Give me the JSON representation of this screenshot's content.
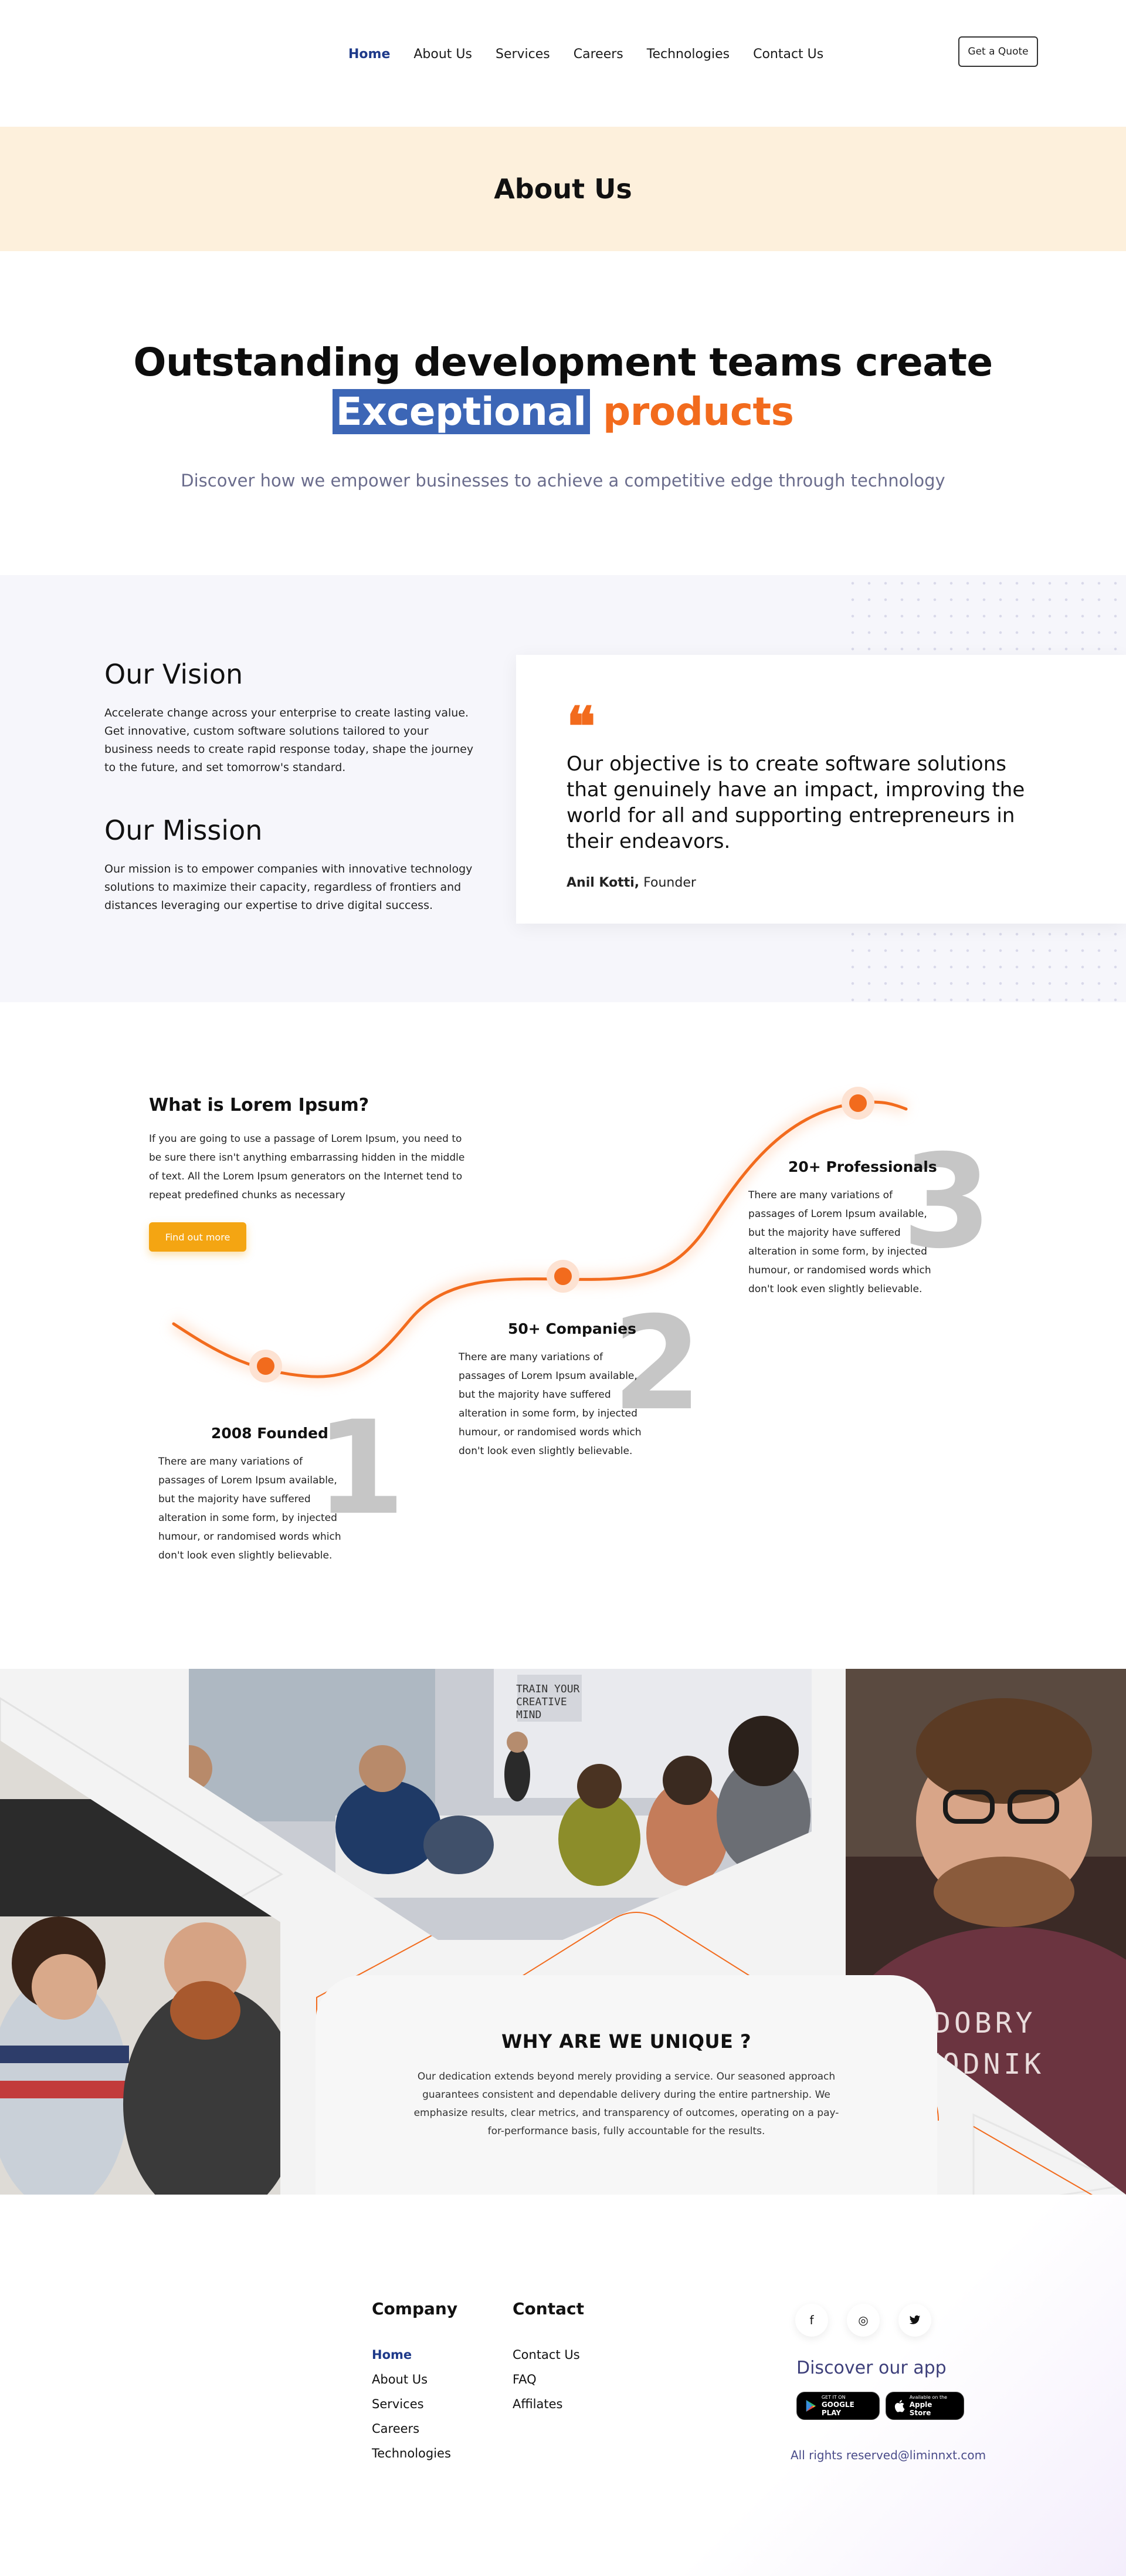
{
  "nav": {
    "links": [
      {
        "label": "Home",
        "active": true
      },
      {
        "label": "About Us"
      },
      {
        "label": "Services"
      },
      {
        "label": "Careers"
      },
      {
        "label": "Technologies"
      },
      {
        "label": "Contact Us"
      }
    ],
    "quote_button": "Get a Quote"
  },
  "banner": {
    "title": "About Us"
  },
  "headline": {
    "line1": "Outstanding development teams create",
    "highlight": "Exceptional",
    "accent": "products",
    "subtitle": "Discover how we empower businesses to achieve a competitive edge through technology"
  },
  "vision": {
    "title": "Our Vision",
    "text": "Accelerate change across your enterprise to create lasting value. Get innovative, custom software solutions tailored to your business needs to create rapid response today, shape the journey to the future, and set tomorrow's standard."
  },
  "mission": {
    "title": "Our Mission",
    "text": "Our mission is to empower companies with innovative technology solutions to maximize their capacity, regardless of frontiers and distances leveraging our expertise to drive digital success."
  },
  "quote": {
    "mark": "❝",
    "text": "Our objective is to create software solutions that genuinely have an impact, improving the world for all and supporting entrepreneurs in their endeavors.",
    "author": "Anil Kotti,",
    "role": " Founder"
  },
  "timeline": {
    "title": "What is Lorem Ipsum?",
    "intro": "If you are going to use a passage of Lorem Ipsum, you need to be sure there isn't anything embarrassing hidden in the middle of text. All the Lorem Ipsum generators on the Internet tend to repeat predefined chunks as necessary",
    "button": "Find out more",
    "milestones": [
      {
        "number": "1",
        "title": "2008 Founded",
        "text": "There are many variations of passages of Lorem Ipsum available, but the majority have suffered alteration in some form, by injected humour, or randomised words which don't look even slightly believable."
      },
      {
        "number": "2",
        "title": "50+ Companies",
        "text": "There are many variations of passages of Lorem Ipsum available, but the majority have suffered alteration in some form, by injected humour, or randomised words which don't look even slightly believable."
      },
      {
        "number": "3",
        "title": "20+ Professionals",
        "text": "There are many variations of passages of Lorem Ipsum available, but the majority have suffered alteration in some form, by injected humour, or randomised words which don't look even slightly believable."
      }
    ]
  },
  "unique": {
    "title": "WHY ARE WE UNIQUE ?",
    "text": "Our dedication extends beyond merely providing a service. Our seasoned approach guarantees consistent and dependable delivery during the entire partnership. We emphasize results, clear metrics, and transparency of outcomes, operating on a pay-for-performance basis, fully accountable for the results.",
    "wall_text": [
      "TRAIN YOUR",
      "CREATIVE",
      "MIND"
    ],
    "shirt_text": [
      "DOBRY",
      "ZAWODNIK"
    ]
  },
  "footer": {
    "company_title": "Company",
    "company_links": [
      {
        "label": "Home",
        "active": true
      },
      {
        "label": "About Us"
      },
      {
        "label": "Services"
      },
      {
        "label": "Careers"
      },
      {
        "label": "Technologies"
      }
    ],
    "contact_title": "Contact",
    "contact_links": [
      {
        "label": "Contact Us"
      },
      {
        "label": "FAQ"
      },
      {
        "label": "Affilates"
      }
    ],
    "socials": [
      {
        "icon": "facebook-icon",
        "glyph": "f"
      },
      {
        "icon": "instagram-icon",
        "glyph": "◎"
      },
      {
        "icon": "twitter-icon",
        "glyph": "🐦"
      }
    ],
    "discover": "Discover our app",
    "google_play": {
      "small": "GET IT ON",
      "big": "GOOGLE PLAY"
    },
    "app_store": {
      "small": "Available on the",
      "big": "Apple Store"
    },
    "rights": "All rights reserved@liminnxt.com"
  },
  "colors": {
    "accent_orange": "#f26b1d",
    "highlight_blue": "#3c66b6",
    "button_yellow": "#f4a512",
    "banner_bg": "#fdf0dc",
    "nav_active": "#1e3a8a"
  }
}
